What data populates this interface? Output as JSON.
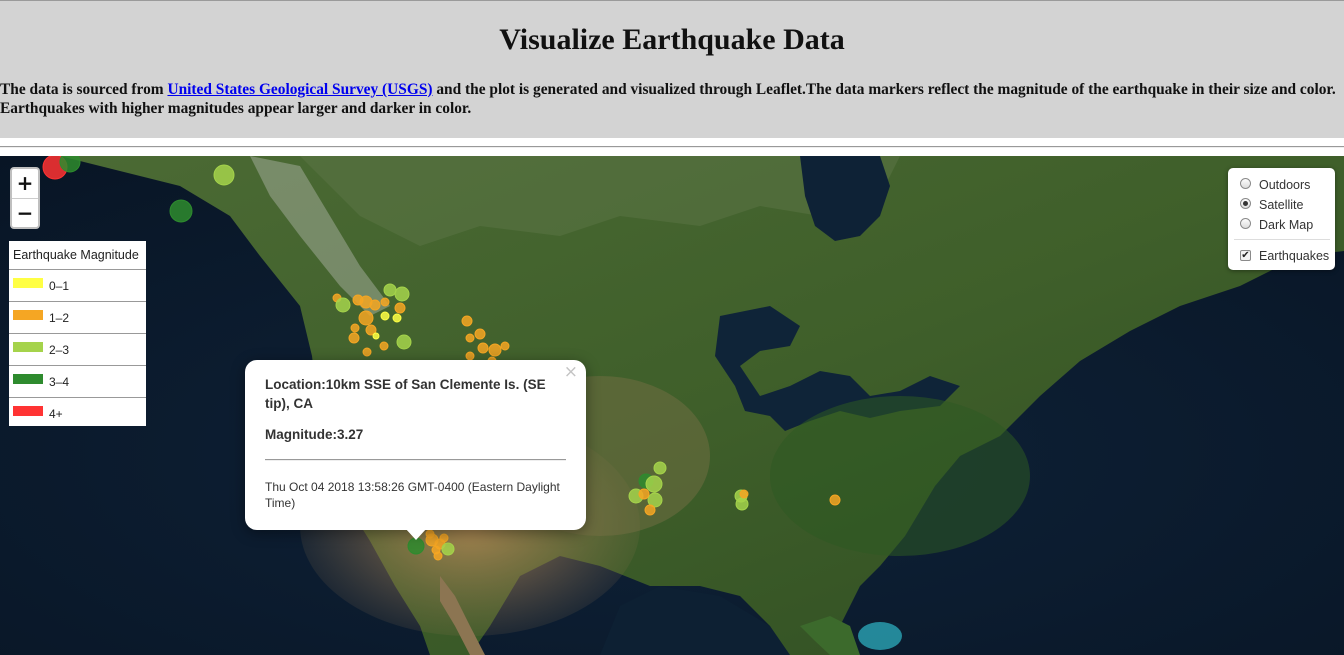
{
  "header": {
    "title": "Visualize Earthquake Data",
    "intro_before": "The data is sourced from ",
    "intro_link": "United States Geological Survey (USGS)",
    "intro_after": " and the plot is generated and visualized through Leaflet.The data markers reflect the magnitude of the earthquake in their size and color. Earthquakes with higher magnitudes appear larger and darker in color."
  },
  "zoom": {
    "in_label": "+",
    "out_label": "−"
  },
  "legend": {
    "title": "Earthquake Magnitude",
    "items": [
      {
        "label": "0–1",
        "color": "#ffff44"
      },
      {
        "label": "1–2",
        "color": "#f5a623"
      },
      {
        "label": "2–3",
        "color": "#a5d34b"
      },
      {
        "label": "3–4",
        "color": "#2e8b2e"
      },
      {
        "label": "4+",
        "color": "#ff3333"
      }
    ]
  },
  "layers": {
    "base": [
      {
        "label": "Outdoors",
        "selected": false
      },
      {
        "label": "Satellite",
        "selected": true
      },
      {
        "label": "Dark Map",
        "selected": false
      }
    ],
    "overlays": [
      {
        "label": "Earthquakes",
        "checked": true
      }
    ]
  },
  "popup": {
    "close": "×",
    "location": "Location:10km SSE of San Clemente Is. (SE tip), CA",
    "magnitude": "Magnitude:3.27",
    "time": "Thu Oct 04 2018 13:58:26 GMT-0400 (Eastern Daylight Time)"
  },
  "colors": {
    "mag_0_1": "#ffff44",
    "mag_1_2": "#f5a623",
    "mag_2_3": "#a5d34b",
    "mag_3_4": "#2e8b2e",
    "mag_4_plus": "#ff3333",
    "link": "#0000ee",
    "page_bg": "#d3d3d3"
  }
}
